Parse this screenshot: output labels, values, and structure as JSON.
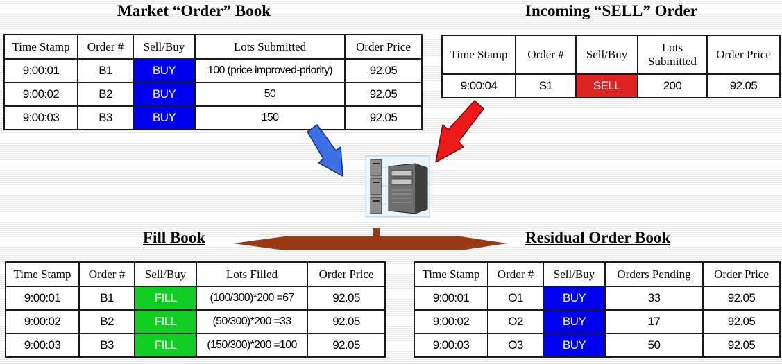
{
  "colors": {
    "buy": "#0000ee",
    "sell": "#dd2222",
    "fill": "#11cc22",
    "arrow_buy": "#3d6fe6",
    "arrow_sell": "#ee1a1a",
    "arrow_route": "#9a3a12"
  },
  "icons": {
    "server": "server-icon"
  },
  "market_book": {
    "title": "Market “Order” Book",
    "headers": [
      "Time Stamp",
      "Order #",
      "Sell/Buy",
      "Lots Submitted",
      "Order Price"
    ],
    "rows": [
      {
        "time": "9:00:01",
        "order": "B1",
        "side": "BUY",
        "lots": "100 (price improved-priority)",
        "price": "92.05"
      },
      {
        "time": "9:00:02",
        "order": "B2",
        "side": "BUY",
        "lots": "50",
        "price": "92.05"
      },
      {
        "time": "9:00:03",
        "order": "B3",
        "side": "BUY",
        "lots": "150",
        "price": "92.05"
      }
    ]
  },
  "incoming": {
    "title": "Incoming “SELL” Order",
    "headers": [
      "Time Stamp",
      "Order #",
      "Sell/Buy",
      "Lots Submitted",
      "Order Price"
    ],
    "rows": [
      {
        "time": "9:00:04",
        "order": "S1",
        "side": "SELL",
        "lots": "200",
        "price": "92.05"
      }
    ]
  },
  "fill_book": {
    "title": "Fill Book",
    "headers": [
      "Time Stamp",
      "Order #",
      "Sell/Buy",
      "Lots Filled",
      "Order Price"
    ],
    "rows": [
      {
        "time": "9:00:01",
        "order": "B1",
        "side": "FILL",
        "lots": "(100/300)*200 =67",
        "price": "92.05"
      },
      {
        "time": "9:00:02",
        "order": "B2",
        "side": "FILL",
        "lots": "(50/300)*200 =33",
        "price": "92.05"
      },
      {
        "time": "9:00:03",
        "order": "B3",
        "side": "FILL",
        "lots": "(150/300)*200 =100",
        "price": "92.05"
      }
    ]
  },
  "residual_book": {
    "title": "Residual Order Book",
    "headers": [
      "Time Stamp",
      "Order #",
      "Sell/Buy",
      "Orders Pending",
      "Order Price"
    ],
    "rows": [
      {
        "time": "9:00:01",
        "order": "O1",
        "side": "BUY",
        "lots": "33",
        "price": "92.05"
      },
      {
        "time": "9:00:02",
        "order": "O2",
        "side": "BUY",
        "lots": "17",
        "price": "92.05"
      },
      {
        "time": "9:00:03",
        "order": "O3",
        "side": "BUY",
        "lots": "50",
        "price": "92.05"
      }
    ]
  }
}
